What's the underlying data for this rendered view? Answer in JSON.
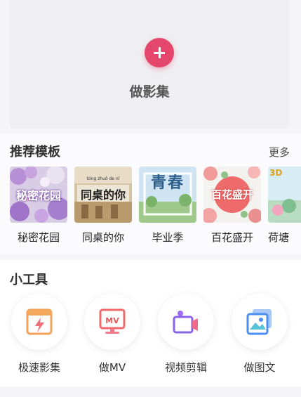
{
  "create": {
    "label": "做影集",
    "icon": "plus-icon"
  },
  "templates": {
    "title": "推荐模板",
    "more": "更多",
    "items": [
      {
        "label": "秘密花园",
        "overlay": "秘密花园"
      },
      {
        "label": "同桌的你",
        "overlay": "同桌的你",
        "pinyin": "tóng zhuō de nǐ"
      },
      {
        "label": "毕业季",
        "overlay": "青春"
      },
      {
        "label": "百花盛开",
        "overlay": "百花盛开"
      },
      {
        "label": "荷塘",
        "overlay": "3D"
      }
    ]
  },
  "tools": {
    "title": "小工具",
    "items": [
      {
        "label": "极速影集",
        "icon": "lightning-card-icon"
      },
      {
        "label": "做MV",
        "icon": "mv-monitor-icon",
        "badge": "MV"
      },
      {
        "label": "视频剪辑",
        "icon": "video-camera-icon"
      },
      {
        "label": "做图文",
        "icon": "image-text-icon"
      }
    ]
  },
  "colors": {
    "accent": "#e5476c",
    "pink": "#f06a8c",
    "purple": "#8b63e8",
    "blue": "#4b8ef0"
  }
}
